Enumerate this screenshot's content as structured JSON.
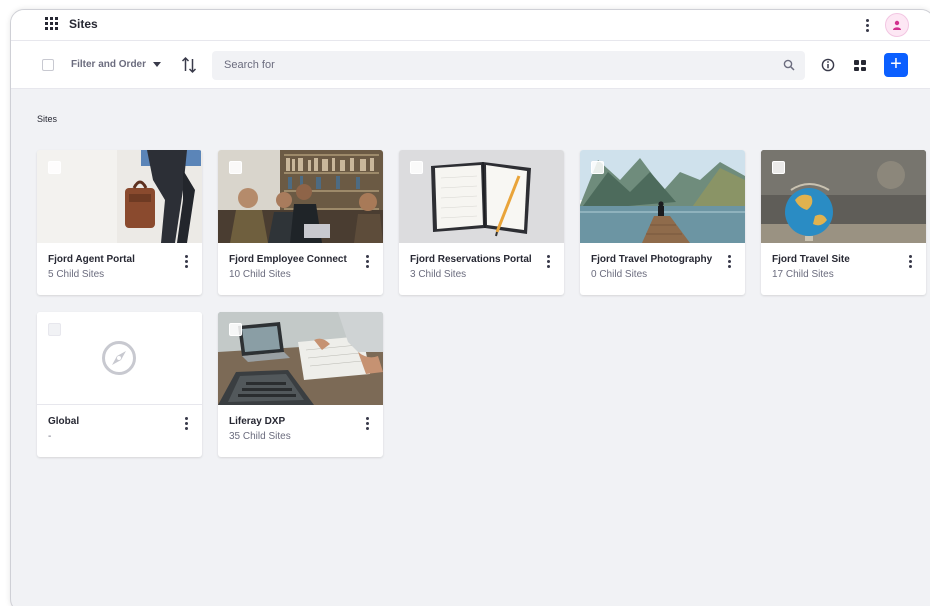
{
  "topbar": {
    "title": "Sites"
  },
  "toolbar": {
    "filter_label": "Filter and Order",
    "search_placeholder": "Search for"
  },
  "section_label": "Sites",
  "colors": {
    "primary": "#0b5fff",
    "text": "#272833",
    "muted": "#6b6c7e",
    "background": "#f1f2f5"
  },
  "sites": [
    {
      "title": "Fjord Agent Portal",
      "subtitle": "5 Child Sites",
      "image": "business-man-briefcase"
    },
    {
      "title": "Fjord Employee Connect",
      "subtitle": "10 Child Sites",
      "image": "team-meeting-library"
    },
    {
      "title": "Fjord Reservations Portal",
      "subtitle": "3 Child Sites",
      "image": "notebook-pencil"
    },
    {
      "title": "Fjord Travel Photography",
      "subtitle": "0 Child Sites",
      "image": "lake-mountains-pier"
    },
    {
      "title": "Fjord Travel Site",
      "subtitle": "17 Child Sites",
      "image": "globe"
    },
    {
      "title": "Global",
      "subtitle": "-",
      "image": "compass-placeholder"
    },
    {
      "title": "Liferay DXP",
      "subtitle": "35 Child Sites",
      "image": "laptops-desk"
    }
  ]
}
